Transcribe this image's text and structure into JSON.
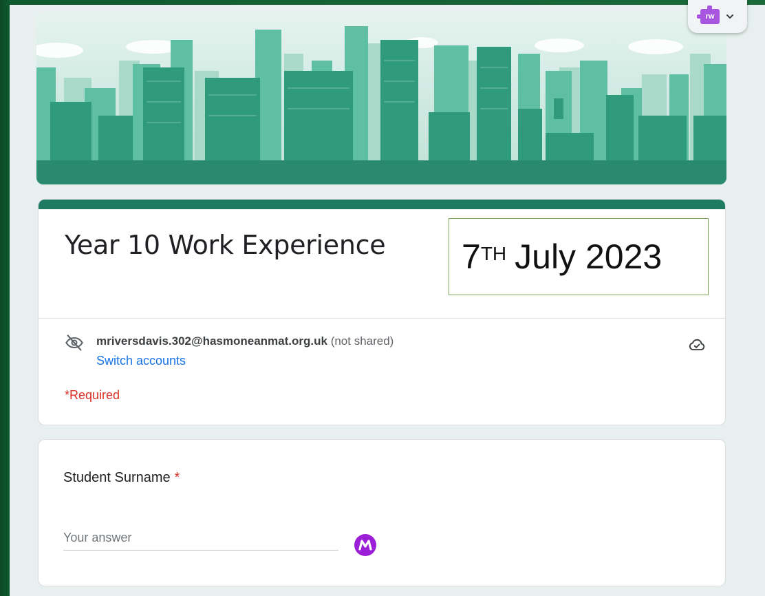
{
  "form": {
    "title": "Year 10 Work Experience",
    "date_overlay": {
      "day": "7",
      "suffix": "TH",
      "rest": "July 2023"
    },
    "account": {
      "email": "mriversdavis.302@hasmoneanmat.org.uk",
      "not_shared": "(not shared)",
      "switch_label": "Switch accounts"
    },
    "required_note": "*Required"
  },
  "question": {
    "label": "Student Surname",
    "required_star": "*",
    "placeholder": "Your answer"
  },
  "extension": {
    "rw_label": "rw"
  },
  "colors": {
    "theme": "#1f7a63",
    "link": "#1a73e8",
    "required": "#d93025",
    "background": "#e7f0ee",
    "extension_purple": "#a855e0",
    "ext_logo_purple": "#9b1fd6"
  }
}
